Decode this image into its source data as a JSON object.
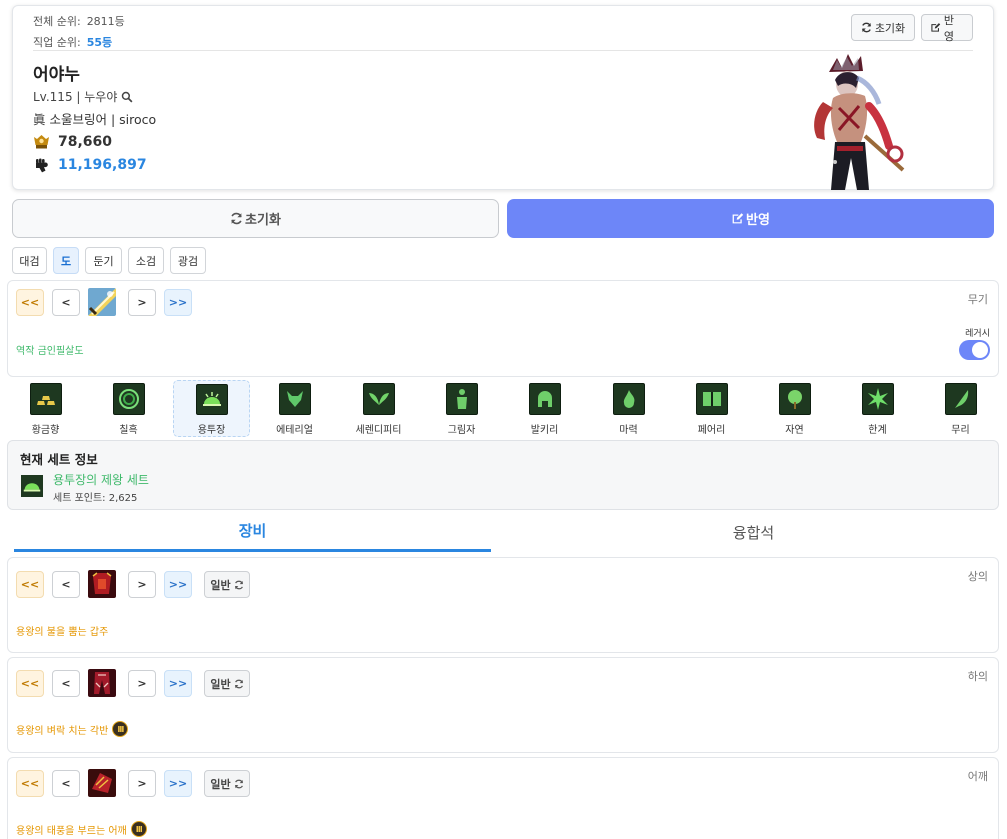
{
  "profile": {
    "total_rank_label": "전체 순위:",
    "total_rank": "2811등",
    "job_rank_label": "직업 순위:",
    "job_rank": "55등",
    "reset_label": "초기화",
    "apply_label": "반영",
    "name": "어야누",
    "level": "Lv.115 | 누우야",
    "job": "眞 소울브링어 | siroco",
    "fame": "78,660",
    "combat_power": "11,196,897"
  },
  "actions": {
    "reset": "초기화",
    "apply": "반영"
  },
  "weapon_tabs": [
    "대검",
    "도",
    "둔기",
    "소검",
    "광검"
  ],
  "weapon_tab_active": "도",
  "weapon": {
    "slot": "무기",
    "item_name": "역작 금인필살도",
    "legacy_label": "레거시",
    "legacy_on": true
  },
  "nav": {
    "first": "<<",
    "prev": "<",
    "next": ">",
    "last": ">>"
  },
  "sets": [
    "황금향",
    "칠흑",
    "용투장",
    "에테리얼",
    "세렌디피티",
    "그림자",
    "발키리",
    "마력",
    "페어리",
    "자연",
    "한계",
    "무리"
  ],
  "set_active": "용투장",
  "set_info": {
    "title": "현재 세트 정보",
    "name": "용투장의 제왕 세트",
    "points": "세트 포인트: 2,625"
  },
  "main_tabs": {
    "equip": "장비",
    "fusion": "융합석"
  },
  "equip_grade_label": "일반",
  "equip_slots": [
    {
      "slot": "상의",
      "item_name": "용왕의 불을 뿜는 갑주",
      "tier": ""
    },
    {
      "slot": "하의",
      "item_name": "용왕의 벼락 치는 각반",
      "tier": "III"
    },
    {
      "slot": "어깨",
      "item_name": "용왕의 태풍을 부르는 어깨",
      "tier": "III"
    }
  ],
  "colors": {
    "accent_blue": "#2a86e0",
    "apply_button": "#6d86f8",
    "set_green": "#3fb96b",
    "item_orange": "#e59600"
  },
  "icons": [
    "refresh-icon",
    "edit-icon",
    "search-icon",
    "fame-icon",
    "fist-icon"
  ]
}
